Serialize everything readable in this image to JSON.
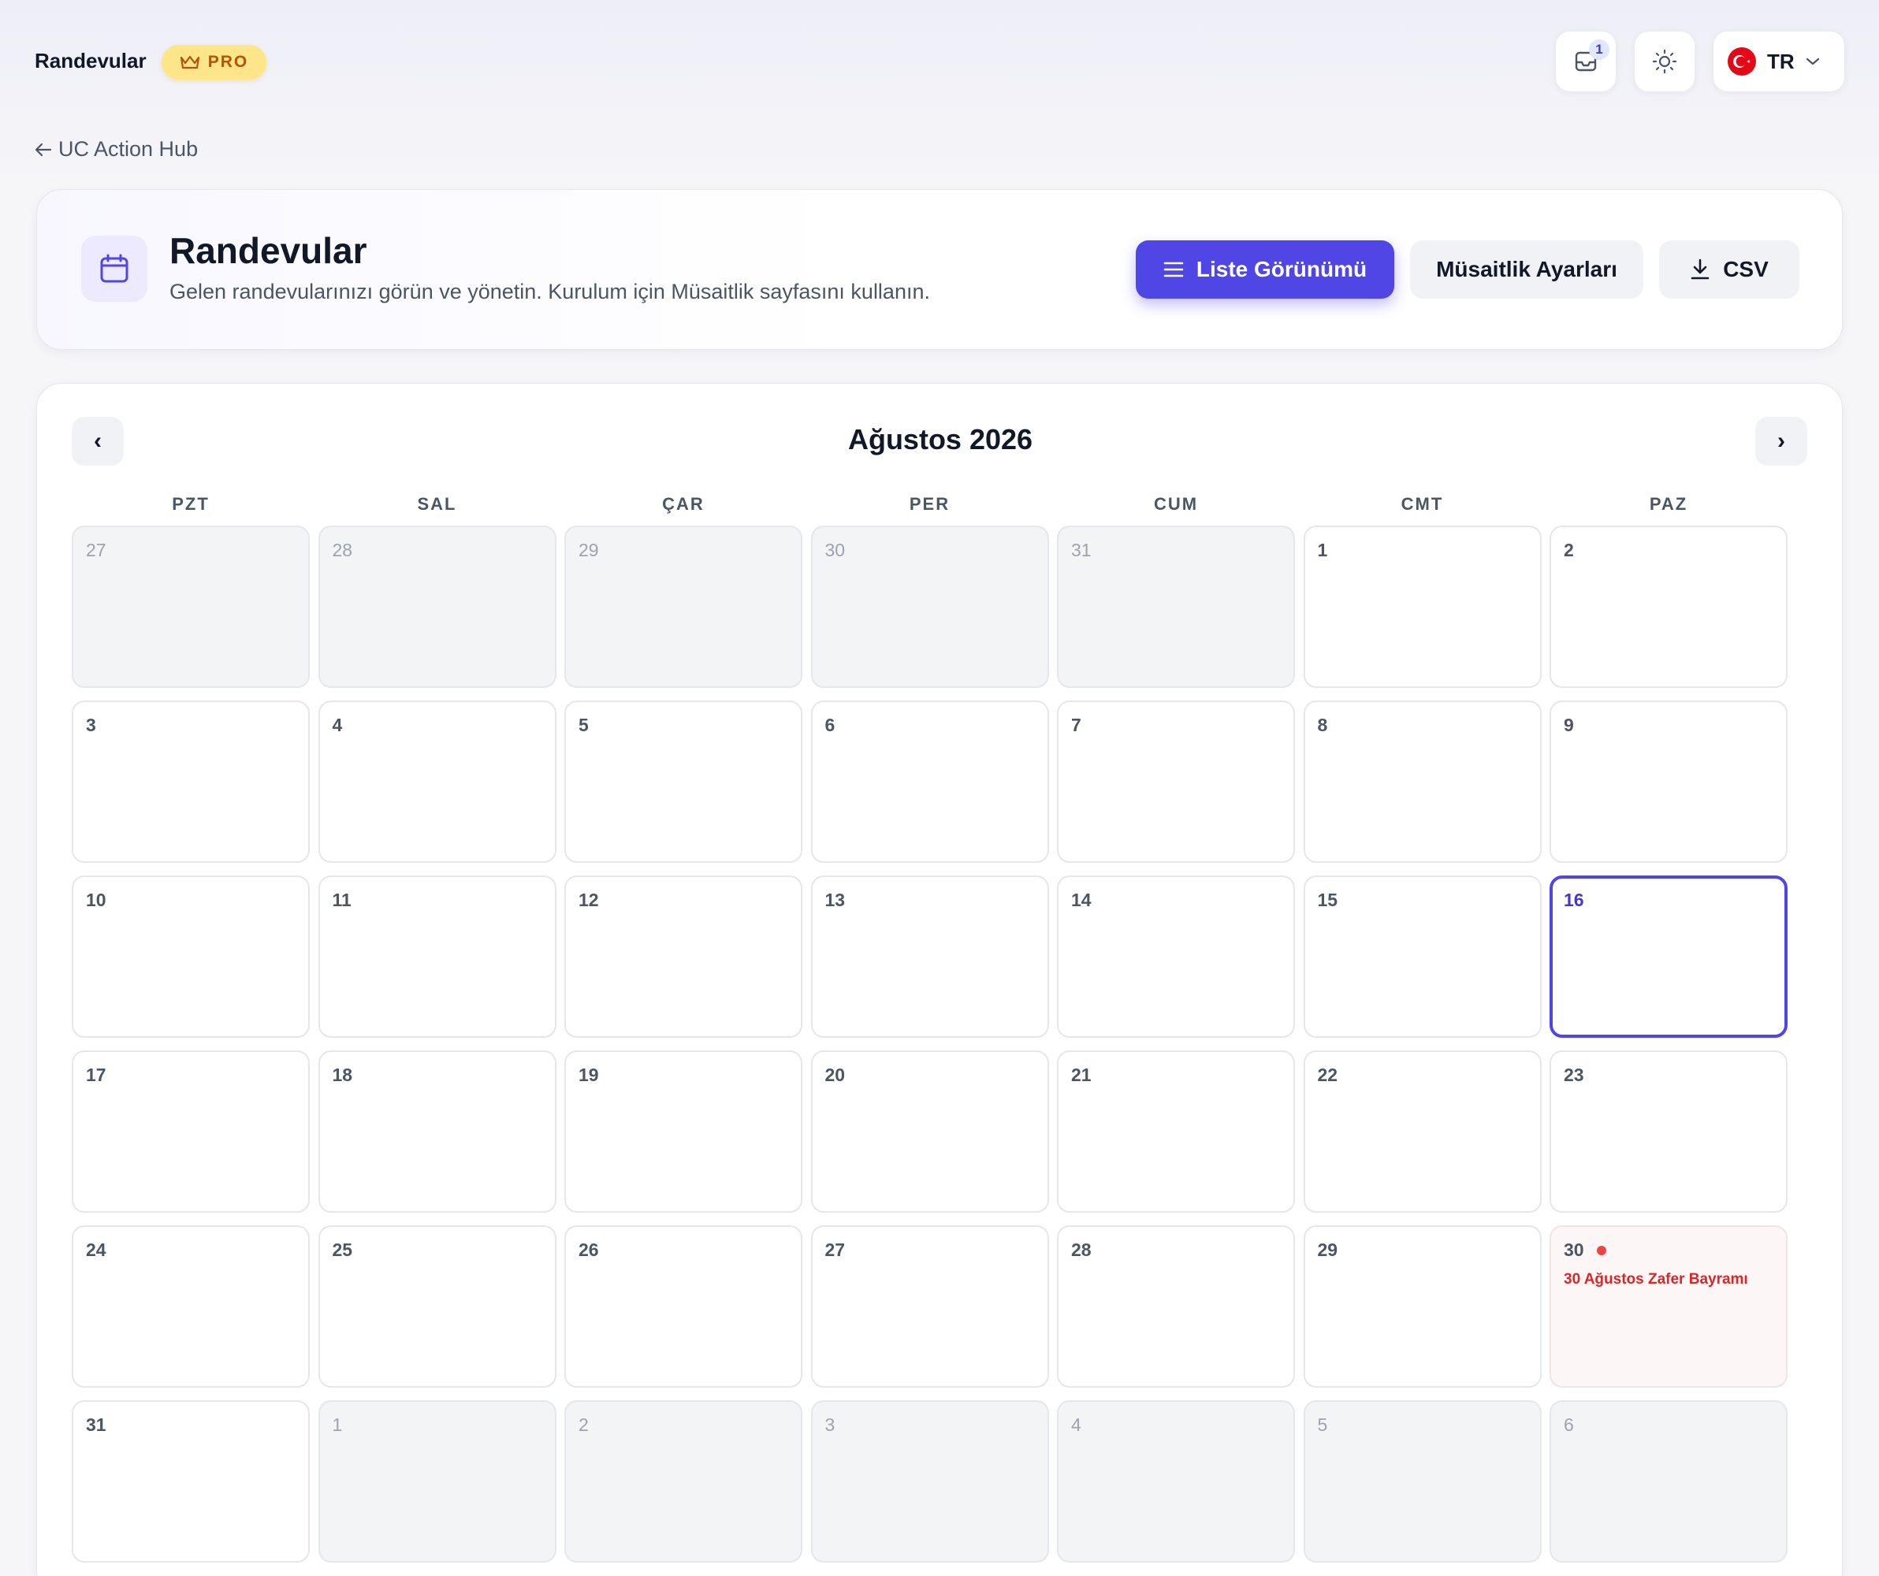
{
  "app": {
    "title": "Randevular",
    "badge": "PRO",
    "notifications_count": "1",
    "language": "TR"
  },
  "back_link": {
    "label": "UC Action Hub"
  },
  "header": {
    "title": "Randevular",
    "subtitle": "Gelen randevularınızı görün ve yönetin. Kurulum için Müsaitlik sayfasını kullanın.",
    "buttons": {
      "list_view": "Liste Görünümü",
      "availability": "Müsaitlik Ayarları",
      "csv": "CSV"
    }
  },
  "calendar": {
    "month_title": "Ağustos 2026",
    "prev_label": "‹",
    "next_label": "›",
    "weekdays": [
      "PZT",
      "SAL",
      "ÇAR",
      "PER",
      "CUM",
      "CMT",
      "PAZ"
    ],
    "today": "16",
    "weeks": [
      [
        {
          "d": "27",
          "out": true
        },
        {
          "d": "28",
          "out": true
        },
        {
          "d": "29",
          "out": true
        },
        {
          "d": "30",
          "out": true
        },
        {
          "d": "31",
          "out": true
        },
        {
          "d": "1"
        },
        {
          "d": "2"
        }
      ],
      [
        {
          "d": "3"
        },
        {
          "d": "4"
        },
        {
          "d": "5"
        },
        {
          "d": "6"
        },
        {
          "d": "7"
        },
        {
          "d": "8"
        },
        {
          "d": "9"
        }
      ],
      [
        {
          "d": "10"
        },
        {
          "d": "11"
        },
        {
          "d": "12"
        },
        {
          "d": "13"
        },
        {
          "d": "14"
        },
        {
          "d": "15"
        },
        {
          "d": "16",
          "today": true
        }
      ],
      [
        {
          "d": "17"
        },
        {
          "d": "18"
        },
        {
          "d": "19"
        },
        {
          "d": "20"
        },
        {
          "d": "21"
        },
        {
          "d": "22"
        },
        {
          "d": "23"
        }
      ],
      [
        {
          "d": "24"
        },
        {
          "d": "25"
        },
        {
          "d": "26"
        },
        {
          "d": "27"
        },
        {
          "d": "28"
        },
        {
          "d": "29"
        },
        {
          "d": "30",
          "holiday": "30 Ağustos Zafer Bayramı"
        }
      ],
      [
        {
          "d": "31"
        },
        {
          "d": "1",
          "out": true
        },
        {
          "d": "2",
          "out": true
        },
        {
          "d": "3",
          "out": true
        },
        {
          "d": "4",
          "out": true
        },
        {
          "d": "5",
          "out": true
        },
        {
          "d": "6",
          "out": true
        }
      ]
    ]
  },
  "colors": {
    "accent": "#4f46e5",
    "today_border": "#4f46e5",
    "holiday_text": "#dc2626",
    "pro_badge_bg": "#fde68a",
    "pro_badge_text": "#b45309"
  },
  "icons": {
    "badge": "crown-icon",
    "inbox": "inbox-icon",
    "theme": "sun-icon",
    "language": "turkey-flag-icon",
    "dropdown": "chevron-down-icon",
    "back": "arrow-left-icon",
    "header": "calendar-icon",
    "list_view": "list-icon",
    "csv": "download-icon"
  }
}
